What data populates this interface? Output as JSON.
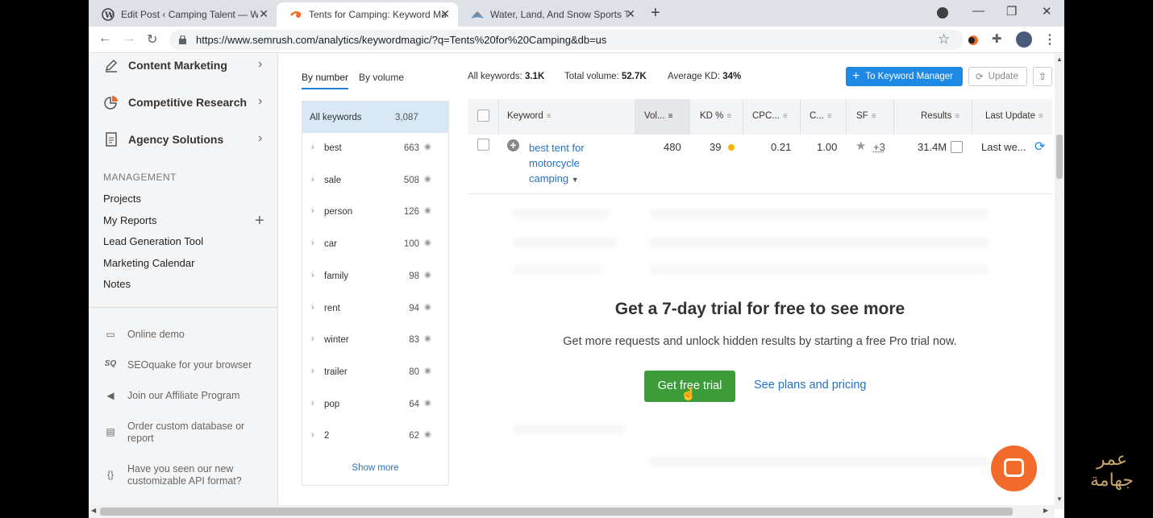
{
  "browser": {
    "tabs": [
      {
        "title": "Edit Post ‹ Camping Talent — Wo",
        "active": false,
        "icon": "wordpress-icon"
      },
      {
        "title": "Tents for Camping: Keyword Mag",
        "active": true,
        "icon": "semrush-icon"
      },
      {
        "title": "Water, Land, And Snow Sports Ti",
        "active": false,
        "icon": "globe-icon"
      }
    ],
    "new_tab": "+",
    "url": "https://www.semrush.com/analytics/keywordmagic/?q=Tents%20for%20Camping&db=us",
    "window_controls": {
      "minimize": "—",
      "restore": "❐",
      "close": "✕"
    }
  },
  "sidebar": {
    "main_items": [
      {
        "label": "Content Marketing",
        "icon": "pen-icon"
      },
      {
        "label": "Competitive Research",
        "icon": "pie-chart-icon"
      },
      {
        "label": "Agency Solutions",
        "icon": "document-icon"
      }
    ],
    "management_title": "MANAGEMENT",
    "management_items": [
      "Projects",
      "My Reports",
      "Lead Generation Tool",
      "Marketing Calendar",
      "Notes"
    ],
    "extra_items": [
      {
        "label": "Online demo",
        "icon": "monitor-icon"
      },
      {
        "label": "SEOquake for your browser",
        "icon": "seoquake-icon"
      },
      {
        "label": "Join our Affiliate Program",
        "icon": "megaphone-icon"
      },
      {
        "label": "Order custom database or report",
        "icon": "clipboard-icon"
      },
      {
        "label": "Have you seen our new customizable API format?",
        "icon": "braces-icon"
      }
    ]
  },
  "groups": {
    "tab_by_number": "By number",
    "tab_by_volume": "By volume",
    "all_label": "All keywords",
    "all_count": "3,087",
    "items": [
      {
        "name": "best",
        "count": "663"
      },
      {
        "name": "sale",
        "count": "508"
      },
      {
        "name": "person",
        "count": "126"
      },
      {
        "name": "car",
        "count": "100"
      },
      {
        "name": "family",
        "count": "98"
      },
      {
        "name": "rent",
        "count": "94"
      },
      {
        "name": "winter",
        "count": "83"
      },
      {
        "name": "trailer",
        "count": "80"
      },
      {
        "name": "pop",
        "count": "64"
      },
      {
        "name": "2",
        "count": "62"
      }
    ],
    "show_more": "Show more"
  },
  "stats": {
    "all_keywords_label": "All keywords:",
    "all_keywords_value": "3.1K",
    "total_volume_label": "Total volume:",
    "total_volume_value": "52.7K",
    "avg_kd_label": "Average KD:",
    "avg_kd_value": "34%"
  },
  "actions": {
    "to_keyword_manager": "To Keyword Manager",
    "update": "Update"
  },
  "table": {
    "headers": [
      "Keyword",
      "Vol...",
      "KD %",
      "CPC...",
      "C...",
      "SF",
      "Results",
      "Last Update"
    ],
    "row": {
      "keyword": "best tent for motorcycle camping",
      "volume": "480",
      "kd": "39",
      "cpc": "0.21",
      "competition": "1.00",
      "sf_extra": "+3",
      "results": "31.4M",
      "last_update": "Last we..."
    }
  },
  "promo": {
    "title": "Get a 7-day trial for free to see more",
    "subtitle": "Get more requests and unlock hidden results by starting a free Pro trial now.",
    "trial_button": "Get free trial",
    "plans_link": "See plans and pricing"
  },
  "watermark": {
    "line1": "عمر",
    "line2": "جهامة"
  },
  "colors": {
    "accent_blue": "#1e88e5",
    "trial_green": "#3b9c39",
    "chat_orange": "#f26b2a",
    "kd_yellow": "#f4b400"
  }
}
